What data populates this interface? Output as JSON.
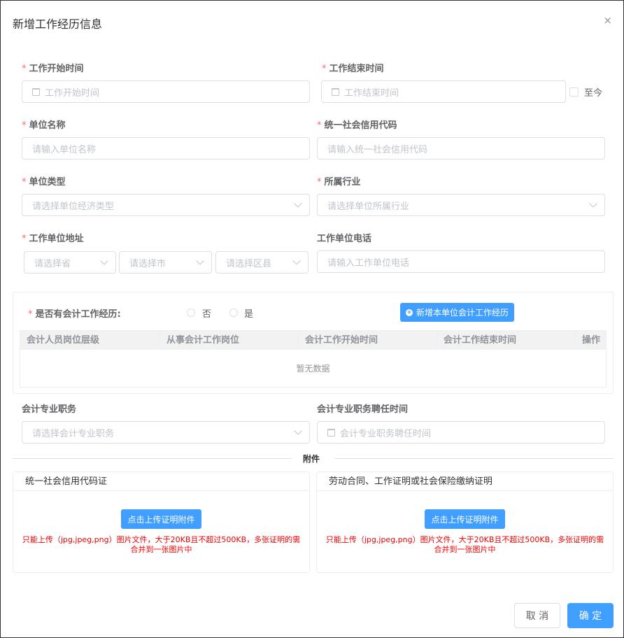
{
  "dialog": {
    "title": "新增工作经历信息",
    "close": "×"
  },
  "form": {
    "start_time": {
      "label": "工作开始时间",
      "placeholder": "工作开始时间",
      "required": "*"
    },
    "end_time": {
      "label": "工作结束时间",
      "placeholder": "工作结束时间",
      "required": "*",
      "until_now": "至今"
    },
    "org_name": {
      "label": "单位名称",
      "placeholder": "请输入单位名称",
      "required": "*"
    },
    "credit_code": {
      "label": "统一社会信用代码",
      "placeholder": "请输入统一社会信用代码",
      "required": "*"
    },
    "org_type": {
      "label": "单位类型",
      "placeholder": "请选择单位经济类型",
      "required": "*"
    },
    "industry": {
      "label": "所属行业",
      "placeholder": "请选择单位所属行业",
      "required": "*"
    },
    "address": {
      "label": "工作单位地址",
      "required": "*",
      "province": "请选择省",
      "city": "请选择市",
      "district": "请选择区县"
    },
    "phone": {
      "label": "工作单位电话",
      "placeholder": "请输入工作单位电话"
    },
    "accounting": {
      "label": "是否有会计工作经历:",
      "required": "*",
      "options": [
        "否",
        "是"
      ],
      "add_button": "新增本单位会计工作经历",
      "columns": [
        "会计人员岗位层级",
        "从事会计工作岗位",
        "会计工作开始时间",
        "会计工作结束时间",
        "操作"
      ],
      "empty": "暂无数据"
    },
    "title_pro": {
      "label": "会计专业职务",
      "placeholder": "请选择会计专业职务"
    },
    "title_time": {
      "label": "会计专业职务聘任时间",
      "placeholder": "会计专业职务聘任时间"
    }
  },
  "attachments": {
    "divider": "附件",
    "cards": [
      {
        "title": "统一社会信用代码证",
        "button": "点击上传证明附件",
        "tip1": "只能上传（jpg,jpeg,png）图片文件，大于20KB且不超过500KB，多张证明的需",
        "tip2": "合并到一张图片中"
      },
      {
        "title": "劳动合同、工作证明或社会保险缴纳证明",
        "button": "点击上传证明附件",
        "tip1": "只能上传（jpg,jpeg,png）图片文件，大于20KB且不超过500KB，多张证明的需",
        "tip2": "合并到一张图片中"
      }
    ]
  },
  "footer": {
    "cancel": "取 消",
    "confirm": "确 定"
  },
  "colors": {
    "primary": "#409eff",
    "required": "#f56c6c",
    "tip": "#e00000"
  }
}
